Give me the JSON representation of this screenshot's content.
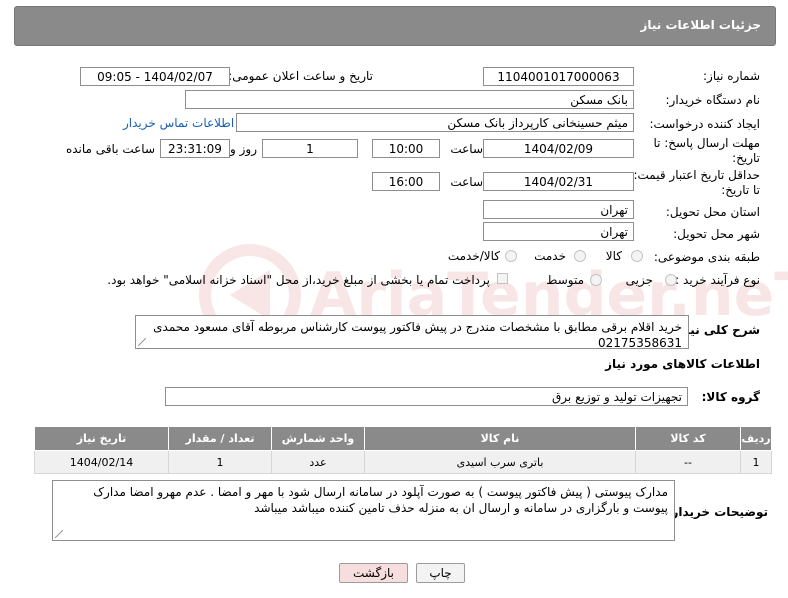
{
  "header": {
    "title": "جزئیات اطلاعات نیاز"
  },
  "fields": {
    "need_number_label": "شماره نیاز:",
    "need_number": "1104001017000063",
    "announce_label": "تاریخ و ساعت اعلان عمومی:",
    "announce_value": "1404/02/07 - 09:05",
    "buyer_org_label": "نام دستگاه خریدار:",
    "buyer_org": "بانک مسکن",
    "creator_label": "ایجاد کننده درخواست:",
    "creator": "میثم حسینخانی کارپرداز بانک مسکن",
    "contact_link": "اطلاعات تماس خریدار",
    "deadline_label_1": "مهلت ارسال پاسخ: تا",
    "deadline_label_2": "تاریخ:",
    "deadline_date": "1404/02/09",
    "time_label": "ساعت",
    "deadline_time": "10:00",
    "days_value": "1",
    "days_label": "روز و",
    "remaining_time": "23:31:09",
    "remaining_label": "ساعت باقی مانده",
    "validity_label_1": "حداقل تاریخ اعتبار قیمت:",
    "validity_label_2": "تا تاریخ:",
    "validity_date": "1404/02/31",
    "validity_time_label": "ساعت",
    "validity_time": "16:00",
    "province_label": "استان محل تحویل:",
    "province": "تهران",
    "city_label": "شهر محل تحویل:",
    "city": "تهران",
    "category_label": "طبقه بندی موضوعی:",
    "category_options": [
      "کالا",
      "خدمت",
      "کالا/خدمت"
    ],
    "process_label": "نوع فرآیند خرید :",
    "process_options": [
      "جزیی",
      "متوسط"
    ],
    "payment_note": "پرداخت تمام یا بخشی از مبلغ خرید،از محل \"اسناد خزانه اسلامی\" خواهد بود."
  },
  "description": {
    "label": "شرح کلی نیاز:",
    "text": "خرید اقلام برقی مطابق با مشخصات مندرج در پیش فاکتور پیوست کارشناس مربوطه آقای مسعود محمدی 02175358631"
  },
  "goods": {
    "section_title": "اطلاعات کالاهای مورد نیاز",
    "group_label": "گروه کالا:",
    "group_value": "تجهیزات تولید و توزیع برق",
    "columns": [
      "ردیف",
      "کد کالا",
      "نام کالا",
      "واحد شمارش",
      "تعداد / مقدار",
      "تاریخ نیاز"
    ],
    "rows": [
      {
        "row": "1",
        "code": "--",
        "name": "باتری سرب اسیدی",
        "unit": "عدد",
        "qty": "1",
        "date": "1404/02/14"
      }
    ]
  },
  "buyer_notes": {
    "label": "توضیحات خریدار:",
    "text": "مدارک پیوستی ( پیش فاکتور پیوست ) به صورت آپلود در سامانه ارسال شود با مهر و امضا . عدم مهرو امضا مدارک پیوست و بارگزاری در سامانه و ارسال ان به منزله حذف تامین کننده میباشد میباشد"
  },
  "buttons": {
    "print": "چاپ",
    "back": "بازگشت"
  },
  "watermark": "AriaTender.neT",
  "colors": {
    "header_bg": "#8a8a8a",
    "link": "#1a5fb4",
    "back_button_bg": "#f7dede"
  }
}
